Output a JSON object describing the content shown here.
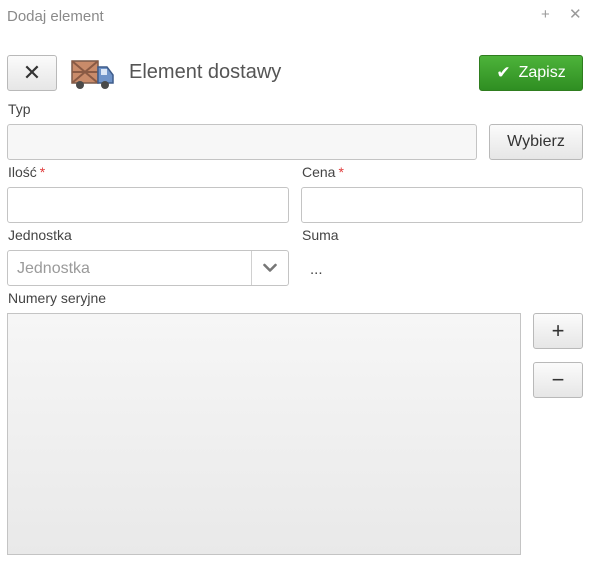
{
  "window": {
    "title": "Dodaj element",
    "add_icon": "+",
    "close_icon": "✕"
  },
  "toolbar": {
    "close_label": "✕",
    "heading": "Element dostawy",
    "save_label": "Zapisz",
    "save_icon": "✔"
  },
  "form": {
    "typ_label": "Typ",
    "typ_value": "",
    "wybierz_label": "Wybierz",
    "ilosc_label": "Ilość",
    "ilosc_value": "",
    "cena_label": "Cena",
    "cena_value": "",
    "required_mark": "*",
    "jednostka_label": "Jednostka",
    "jednostka_placeholder": "Jednostka",
    "suma_label": "Suma",
    "suma_value": "...",
    "numery_label": "Numery seryjne",
    "plus_label": "+",
    "minus_label": "−"
  },
  "colors": {
    "save_button": "#3ea32e",
    "required": "#e03a3a"
  }
}
